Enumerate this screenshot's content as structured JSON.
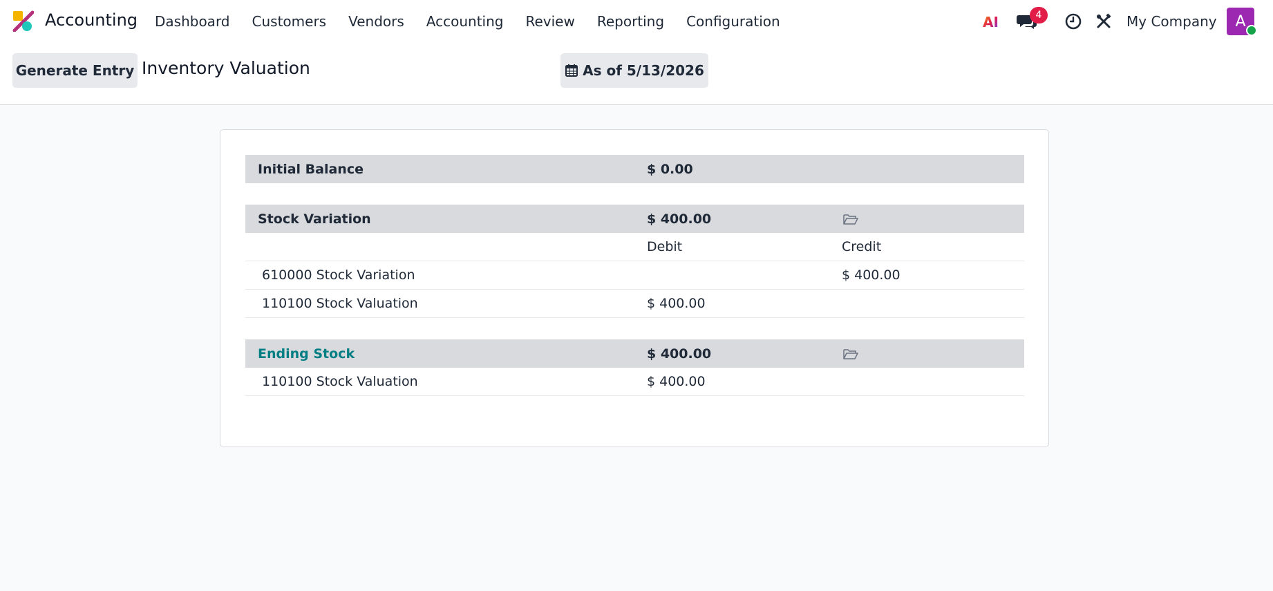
{
  "navbar": {
    "app_name": "Accounting",
    "menu": [
      "Dashboard",
      "Customers",
      "Vendors",
      "Accounting",
      "Review",
      "Reporting",
      "Configuration"
    ],
    "ai_icon_text": "AI",
    "chat_badge": "4",
    "company": "My Company",
    "avatar_letter": "A",
    "colors": {
      "brand_accent": "#9c27b0",
      "badge": "#e11d48",
      "online": "#16a34a"
    }
  },
  "control_panel": {
    "generate_label": "Generate Entry",
    "title": "Inventory Valuation",
    "date_label": "As of 5/13/2026"
  },
  "report": {
    "initial_balance": {
      "label": "Initial Balance",
      "amount": "$ 0.00"
    },
    "stock_variation": {
      "label": "Stock Variation",
      "amount": "$ 400.00",
      "debit_header": "Debit",
      "credit_header": "Credit",
      "lines": [
        {
          "account": "610000 Stock Variation",
          "debit": "",
          "credit": "$ 400.00"
        },
        {
          "account": "110100 Stock Valuation",
          "debit": "$ 400.00",
          "credit": ""
        }
      ]
    },
    "ending_stock": {
      "label": "Ending Stock",
      "amount": "$ 400.00",
      "lines": [
        {
          "account": "110100 Stock Valuation",
          "debit": "$ 400.00"
        }
      ]
    },
    "colors": {
      "section_bg": "#d8dadd",
      "link": "#017e84"
    }
  }
}
